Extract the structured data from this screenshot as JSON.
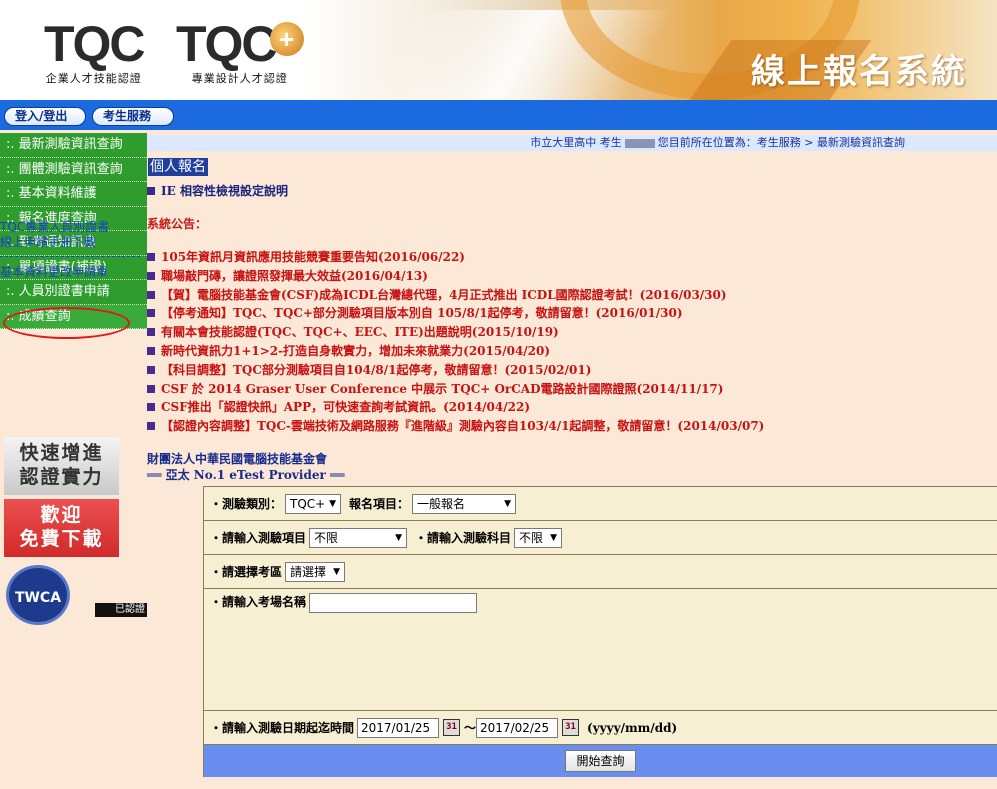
{
  "header": {
    "logo1_mark": "TQC",
    "logo1_caption": "企業人才技能認證",
    "logo2_mark": "TQC",
    "logo2_plus": "+",
    "logo2_caption": "專業設計人才認證",
    "system_title": "線上報名系統"
  },
  "nav": {
    "login": "登入/登出",
    "service": "考生服務"
  },
  "sidebar": {
    "items": [
      {
        "label": ":. 最新測驗資訊查詢"
      },
      {
        "label": ":. 團體測驗資訊查詢"
      },
      {
        "label": ":. 基本資料維護"
      },
      {
        "label": ":. 報名進度查詢"
      },
      {
        "label": ":. 到考通知訊息"
      },
      {
        "label": ":. 單項證書(補證)"
      },
      {
        "label": ":. 人員別證書申請"
      },
      {
        "label": ":. 成績查詢"
      }
    ],
    "link1": "TQC專業人員別證書",
    "link2": "線上申請手冊下載",
    "link3": "基本資料更改申請單",
    "promo1_line1": "快速增進",
    "promo1_line2": "認證實力",
    "promo2_line1": "歡迎",
    "promo2_line2": "免費下載",
    "twca_badge": "TWCA",
    "cert_label": "已認證"
  },
  "infobar": {
    "school": "市立大里高中 考生",
    "location_prefix": "您目前所在位置為：考生服務 >",
    "location_current": "最新測驗資訊查詢"
  },
  "section_title": "個人報名",
  "ie_note": "IE 相容性檢視設定說明",
  "announcement_title": "系統公告：",
  "news": [
    "105年資訊月資訊應用技能競賽重要告知(2016/06/22)",
    "職場敲門磚，讓證照發揮最大效益(2016/04/13)",
    "【賀】電腦技能基金會(CSF)成為ICDL台灣總代理，4月正式推出 ICDL國際認證考試！(2016/03/30)",
    "【停考通知】TQC、TQC+部分測驗項目版本別自 105/8/1起停考，敬請留意！(2016/01/30)",
    "有關本會技能認證(TQC、TQC+、EEC、ITE)出題說明(2015/10/19)",
    "新時代資訊力1+1>2-打造自身軟實力，增加未來就業力(2015/04/20)",
    "【科目調整】TQC部分測驗項目自104/8/1起停考，敬請留意！(2015/02/01)",
    "CSF 於 2014 Graser User Conference 中展示 TQC+ OrCAD電路設計國際證照(2014/11/17)",
    "CSF推出「認證快訊」APP，可快速查詢考試資訊。(2014/04/22)",
    "【認證內容調整】TQC-雲端技術及網路服務『進階級』測驗內容自103/4/1起調整，敬請留意！(2014/03/07)"
  ],
  "org": {
    "name": "財團法人中華民國電腦技能基金會",
    "slogan": "══ 亞太 No.1 eTest Provider ══"
  },
  "form": {
    "row1_label1": "‧測驗類別：",
    "row1_select1": "TQC+",
    "row1_label2": "報名項目：",
    "row1_select2": "一般報名",
    "row2_label1": "‧請輸入測驗項目",
    "row2_select1": "不限",
    "row2_label2": "‧請輸入測驗科目",
    "row2_select2": "不限",
    "row3_label": "‧請選擇考區",
    "row3_select": "請選擇",
    "row4_label": "‧請輸入考場名稱",
    "row4_value": "",
    "row5_label": "‧請輸入測驗日期起迄時間",
    "date_start": "2017/01/25",
    "date_sep": "～",
    "date_end": "2017/02/25",
    "date_format": "(yyyy/mm/dd)",
    "calendar_icon_text": "31",
    "submit_label": "開始查詢"
  },
  "colors": {
    "nav_blue": "#1b6ae0",
    "menu_green": "#2e9d2e",
    "news_red": "#c81212",
    "page_bg": "#fbe8d6"
  }
}
